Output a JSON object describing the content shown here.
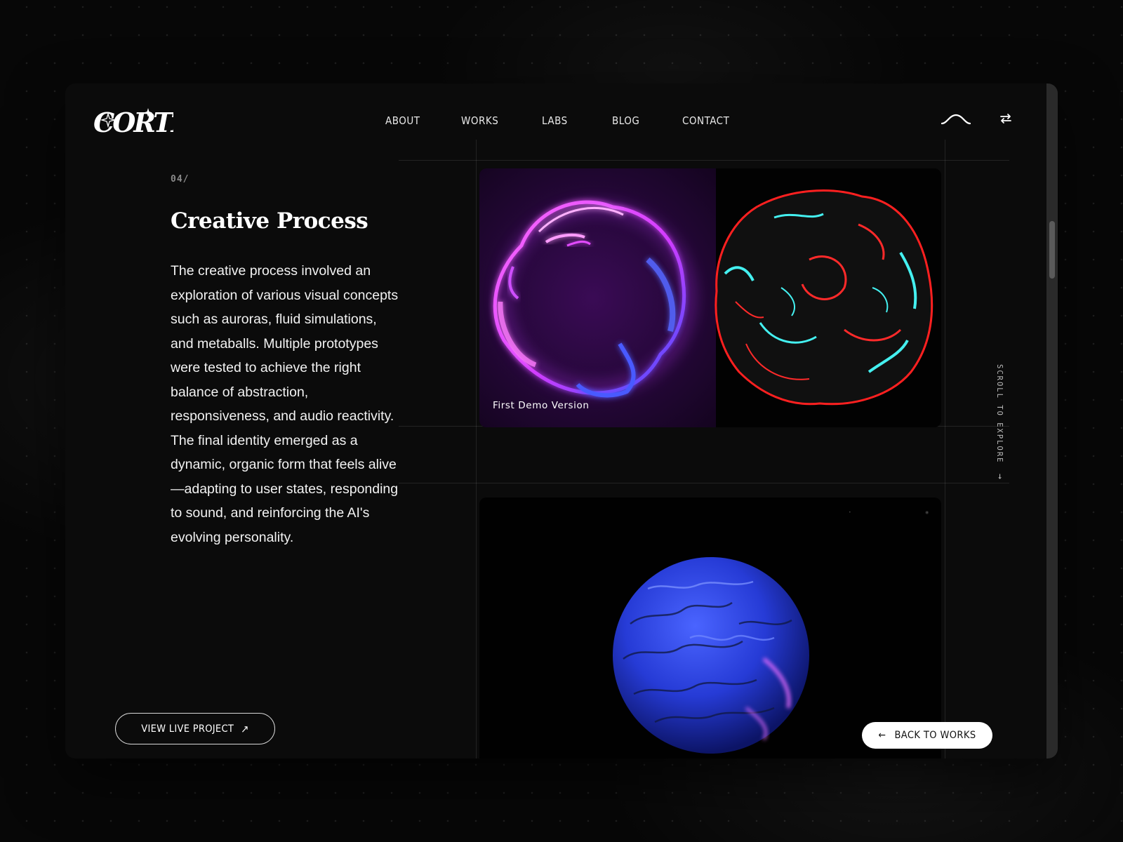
{
  "brand": {
    "logo_text": "CORTIZ"
  },
  "nav": {
    "items": [
      {
        "label": "ABOUT"
      },
      {
        "label": "WORKS"
      },
      {
        "label": "LABS"
      },
      {
        "label": "BLOG"
      },
      {
        "label": "CONTACT"
      }
    ]
  },
  "header_icons": {
    "wave": "wave-icon",
    "swap": "swap-arrows-icon"
  },
  "section": {
    "number": "04/",
    "title": "Creative Process",
    "body": "The creative process involved an exploration of various visual concepts such as auroras, fluid simulations, and metaballs. Multiple prototypes were tested to achieve the right balance of abstraction, responsiveness, and audio reactivity. The final identity emerged as a dynamic, organic form that feels alive—adapting to user states, responding to sound, and reinforcing the AI's evolving personality."
  },
  "gallery": {
    "card1_caption": "First Demo Version"
  },
  "scroll_hint": {
    "label": "SCROLL TO EXPLORE",
    "arrow": "→"
  },
  "buttons": {
    "view_live": "VIEW LIVE PROJECT",
    "view_live_icon": "↗",
    "back_to_works": "BACK TO WORKS",
    "back_icon": "←"
  },
  "colors": {
    "background": "#070707",
    "panel": "#0b0b0b",
    "purple_glow": "#c43cff",
    "blue_glow": "#3a4dff",
    "cyan_accent": "#3ff0f0",
    "red_accent": "#ff1a1a",
    "sphere_blue": "#2538c9"
  }
}
